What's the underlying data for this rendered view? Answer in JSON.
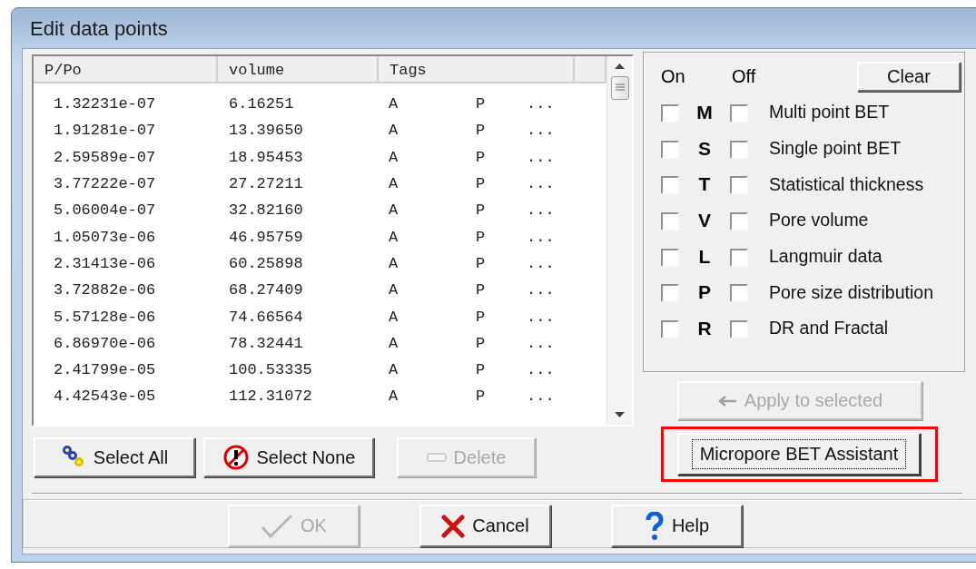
{
  "window": {
    "title": "Edit data points"
  },
  "table": {
    "columns": [
      "P/Po",
      "volume",
      "Tags"
    ],
    "rows": [
      {
        "p_po": "1.32231e-07",
        "volume": "6.16251",
        "tags": [
          "A",
          "P",
          "..."
        ]
      },
      {
        "p_po": "1.91281e-07",
        "volume": "13.39650",
        "tags": [
          "A",
          "P",
          "..."
        ]
      },
      {
        "p_po": "2.59589e-07",
        "volume": "18.95453",
        "tags": [
          "A",
          "P",
          "..."
        ]
      },
      {
        "p_po": "3.77222e-07",
        "volume": "27.27211",
        "tags": [
          "A",
          "P",
          "..."
        ]
      },
      {
        "p_po": "5.06004e-07",
        "volume": "32.82160",
        "tags": [
          "A",
          "P",
          "..."
        ]
      },
      {
        "p_po": "1.05073e-06",
        "volume": "46.95759",
        "tags": [
          "A",
          "P",
          "..."
        ]
      },
      {
        "p_po": "2.31413e-06",
        "volume": "60.25898",
        "tags": [
          "A",
          "P",
          "..."
        ]
      },
      {
        "p_po": "3.72882e-06",
        "volume": "68.27409",
        "tags": [
          "A",
          "P",
          "..."
        ]
      },
      {
        "p_po": "5.57128e-06",
        "volume": "74.66564",
        "tags": [
          "A",
          "P",
          "..."
        ]
      },
      {
        "p_po": "6.86970e-06",
        "volume": "78.32441",
        "tags": [
          "A",
          "P",
          "..."
        ]
      },
      {
        "p_po": "2.41799e-05",
        "volume": "100.53335",
        "tags": [
          "A",
          "P",
          "..."
        ]
      },
      {
        "p_po": "4.42543e-05",
        "volume": "112.31072",
        "tags": [
          "A",
          "P",
          "..."
        ]
      }
    ]
  },
  "tag_panel": {
    "on_label": "On",
    "off_label": "Off",
    "clear_button": "Clear",
    "options": [
      {
        "letter": "M",
        "label": "Multi point BET",
        "on_checked": false,
        "off_checked": false
      },
      {
        "letter": "S",
        "label": "Single point BET",
        "on_checked": false,
        "off_checked": false
      },
      {
        "letter": "T",
        "label": "Statistical thickness",
        "on_checked": false,
        "off_checked": false
      },
      {
        "letter": "V",
        "label": "Pore volume",
        "on_checked": false,
        "off_checked": false
      },
      {
        "letter": "L",
        "label": "Langmuir data",
        "on_checked": false,
        "off_checked": false
      },
      {
        "letter": "P",
        "label": "Pore size distribution",
        "on_checked": false,
        "off_checked": false
      },
      {
        "letter": "R",
        "label": "DR and Fractal",
        "on_checked": false,
        "off_checked": false
      }
    ]
  },
  "apply_button": {
    "label": "Apply to selected",
    "kind": "arrow",
    "disabled": true
  },
  "assistant_button": {
    "label": "Micropore BET Assistant",
    "focused": true,
    "highlighted": true
  },
  "list_buttons": [
    {
      "label": "Select All",
      "kind": "select-all",
      "disabled": false
    },
    {
      "label": "Select None",
      "kind": "select-none",
      "disabled": false
    },
    {
      "label": "Delete",
      "kind": "delete",
      "disabled": true
    }
  ],
  "footer_buttons": [
    {
      "label": "OK",
      "kind": "ok",
      "disabled": true
    },
    {
      "label": "Cancel",
      "kind": "cancel",
      "disabled": false
    },
    {
      "label": "Help",
      "kind": "help",
      "disabled": false
    }
  ]
}
